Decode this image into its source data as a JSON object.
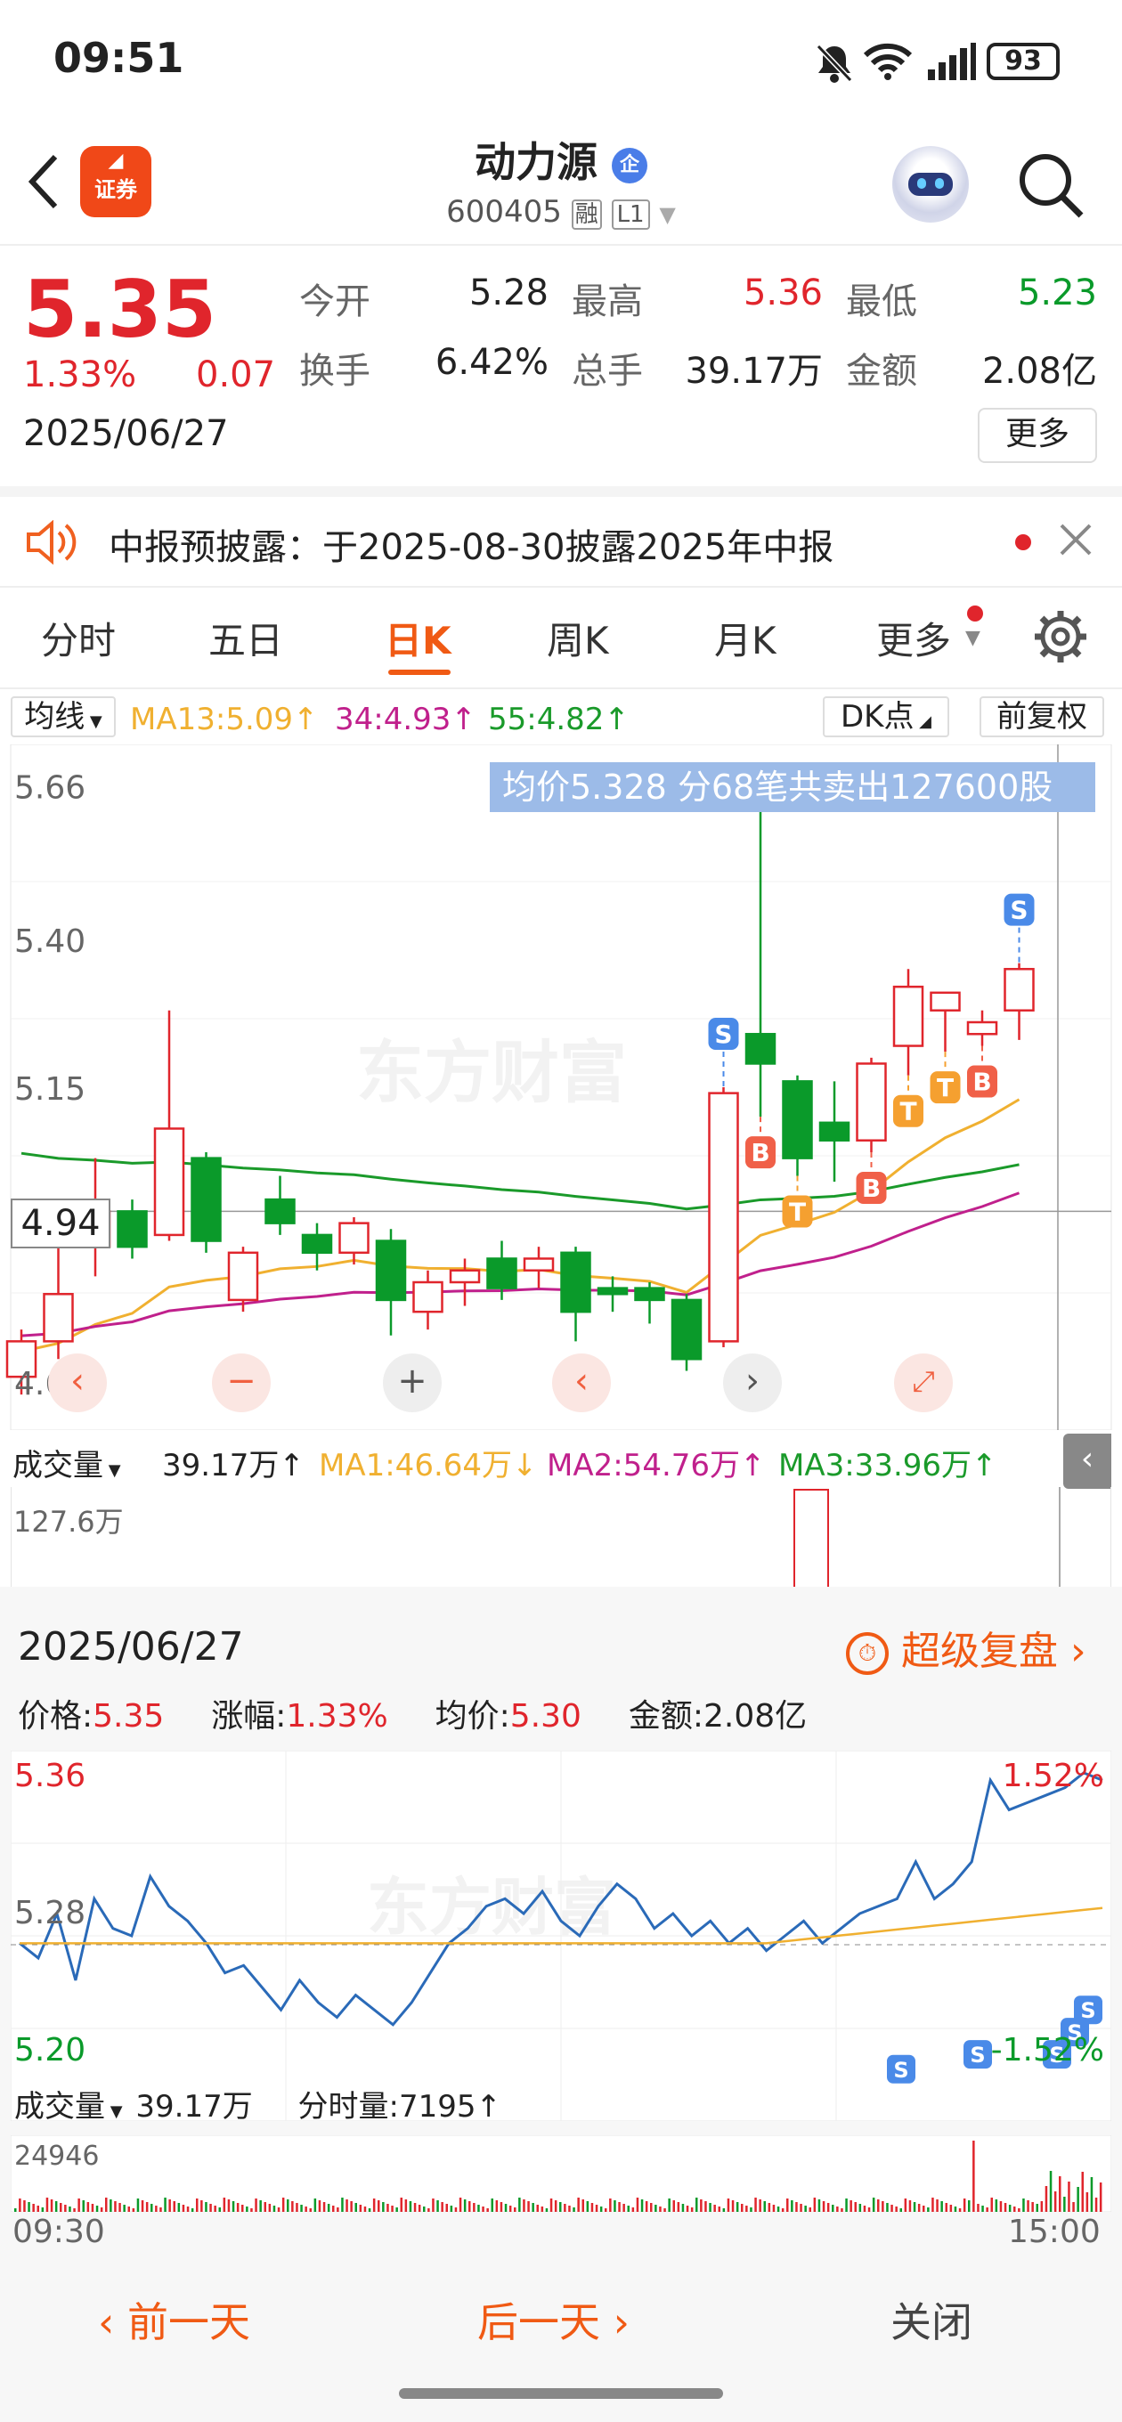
{
  "status_bar": {
    "time": "09:51",
    "battery": "93"
  },
  "header": {
    "stock_name": "动力源",
    "badge": "企",
    "code": "600405",
    "tag_rong": "融",
    "tag_level": "L1",
    "logo_text": "证券"
  },
  "quote": {
    "price": "5.35",
    "change_pct": "1.33%",
    "change": "0.07",
    "date": "2025/06/27",
    "open_label": "今开",
    "open": "5.28",
    "high_label": "最高",
    "high": "5.36",
    "low_label": "最低",
    "low": "5.23",
    "turnover_label": "换手",
    "turnover": "6.42%",
    "volume_label": "总手",
    "volume": "39.17万",
    "amount_label": "金额",
    "amount": "2.08亿",
    "more": "更多"
  },
  "notice": {
    "text": "中报预披露：于2025-08-30披露2025年中报"
  },
  "tabs": [
    "分时",
    "五日",
    "日K",
    "周K",
    "月K",
    "更多"
  ],
  "active_tab": "日K",
  "kline": {
    "indicator": "均线",
    "ma13": "MA13:5.09↑",
    "ma34": "34:4.93↑",
    "ma55": "55:4.82↑",
    "dk_button": "DK点",
    "adjust_button": "前复权",
    "tooltip": "均价5.328  分68笔共卖出127600股",
    "y_labels": [
      "5.66",
      "5.40",
      "5.15",
      "4.63"
    ],
    "crosshair_value": "4.94",
    "colors": {
      "up": "#e0252c",
      "down": "#0a9a2a",
      "ma13": "#f0b030",
      "ma34": "#c0208c",
      "ma55": "#1a9a2a"
    },
    "candles": [
      {
        "o": 4.66,
        "c": 4.72,
        "h": 4.74,
        "l": 4.63
      },
      {
        "o": 4.72,
        "c": 4.8,
        "h": 4.94,
        "l": 4.69
      },
      {
        "o": 4.88,
        "c": 4.94,
        "h": 5.03,
        "l": 4.83
      },
      {
        "o": 4.94,
        "c": 4.88,
        "h": 4.96,
        "l": 4.86
      },
      {
        "o": 4.9,
        "c": 5.08,
        "h": 5.28,
        "l": 4.89
      },
      {
        "o": 5.03,
        "c": 4.89,
        "h": 5.04,
        "l": 4.87
      },
      {
        "o": 4.79,
        "c": 4.87,
        "h": 4.88,
        "l": 4.77
      },
      {
        "o": 4.96,
        "c": 4.92,
        "h": 5.0,
        "l": 4.9
      },
      {
        "o": 4.9,
        "c": 4.87,
        "h": 4.92,
        "l": 4.84
      },
      {
        "o": 4.87,
        "c": 4.92,
        "h": 4.93,
        "l": 4.85
      },
      {
        "o": 4.89,
        "c": 4.79,
        "h": 4.91,
        "l": 4.73
      },
      {
        "o": 4.77,
        "c": 4.82,
        "h": 4.84,
        "l": 4.74
      },
      {
        "o": 4.82,
        "c": 4.84,
        "h": 4.86,
        "l": 4.78
      },
      {
        "o": 4.86,
        "c": 4.81,
        "h": 4.89,
        "l": 4.79
      },
      {
        "o": 4.84,
        "c": 4.86,
        "h": 4.88,
        "l": 4.81
      },
      {
        "o": 4.87,
        "c": 4.77,
        "h": 4.88,
        "l": 4.72
      },
      {
        "o": 4.81,
        "c": 4.8,
        "h": 4.83,
        "l": 4.77
      },
      {
        "o": 4.81,
        "c": 4.79,
        "h": 4.82,
        "l": 4.75
      },
      {
        "o": 4.79,
        "c": 4.69,
        "h": 4.8,
        "l": 4.67
      },
      {
        "o": 4.72,
        "c": 5.14,
        "h": 5.15,
        "l": 4.71
      },
      {
        "o": 5.24,
        "c": 5.19,
        "h": 5.66,
        "l": 5.1
      },
      {
        "o": 5.16,
        "c": 5.03,
        "h": 5.17,
        "l": 5.0
      },
      {
        "o": 5.09,
        "c": 5.06,
        "h": 5.16,
        "l": 4.99
      },
      {
        "o": 5.06,
        "c": 5.19,
        "h": 5.2,
        "l": 5.04
      },
      {
        "o": 5.22,
        "c": 5.32,
        "h": 5.35,
        "l": 5.17
      },
      {
        "o": 5.28,
        "c": 5.31,
        "h": 5.31,
        "l": 5.21
      },
      {
        "o": 5.24,
        "c": 5.26,
        "h": 5.28,
        "l": 5.22
      },
      {
        "o": 5.28,
        "c": 5.35,
        "h": 5.36,
        "l": 5.23
      }
    ],
    "markers": [
      {
        "type": "S",
        "i": 19
      },
      {
        "type": "B",
        "i": 20
      },
      {
        "type": "T",
        "i": 21
      },
      {
        "type": "B",
        "i": 23
      },
      {
        "type": "T",
        "i": 24
      },
      {
        "type": "T",
        "i": 25
      },
      {
        "type": "B",
        "i": 26
      },
      {
        "type": "S",
        "i": 27
      }
    ]
  },
  "volume": {
    "label": "成交量",
    "value": "39.17万↑",
    "ma1": "MA1:46.64万↓",
    "ma2": "MA2:54.76万↑",
    "ma3": "MA3:33.96万↑",
    "max_label": "127.6万"
  },
  "detail": {
    "date": "2025/06/27",
    "replay": "超级复盘",
    "price_label": "价格:",
    "price": "5.35",
    "pct_label": "涨幅:",
    "pct": "1.33%",
    "avg_label": "均价:",
    "avg": "5.30",
    "amount_label": "金额:",
    "amount": "2.08亿",
    "y_top": "5.36",
    "y_mid": "5.28",
    "y_bottom": "5.20",
    "pct_top": "1.52%",
    "pct_bottom": "-1.52%",
    "vol_label": "成交量",
    "vol_value": "39.17万",
    "tick_vol": "分时量:7195↑",
    "vol_max": "24946",
    "time_start": "09:30",
    "time_end": "15:00"
  },
  "footer": {
    "prev": "前一天",
    "next": "后一天",
    "close": "关闭"
  }
}
